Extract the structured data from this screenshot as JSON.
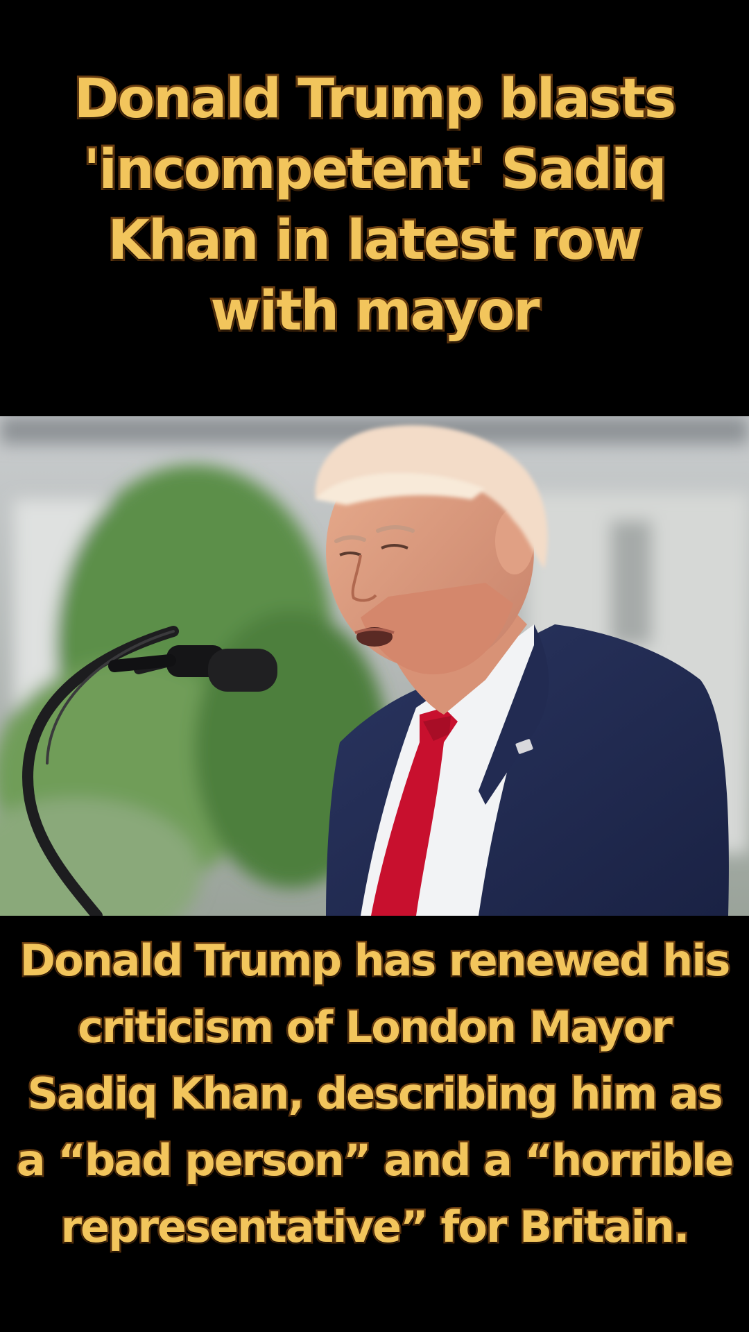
{
  "headline": "Donald Trump blasts 'incompetent' Sadiq Khan in latest row with mayor",
  "body": "Donald Trump has renewed his criticism of London Mayor Sadiq Khan, describing him as a “bad person” and a “horrible representative” for Britain.",
  "colors": {
    "background": "#000000",
    "caption_fill": "#f2c55c",
    "caption_outline": "#6b3d10"
  }
}
